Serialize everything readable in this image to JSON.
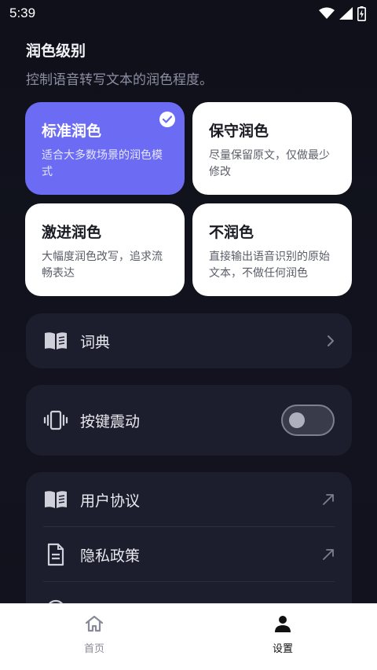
{
  "status_bar": {
    "time": "5:39",
    "icons": [
      "wifi-icon",
      "signal-icon",
      "battery-charging-icon"
    ]
  },
  "polish_level": {
    "title": "润色级别",
    "subtitle": "控制语音转写文本的润色程度。",
    "options": [
      {
        "name": "标准润色",
        "desc": "适合大多数场景的润色模式",
        "selected": true
      },
      {
        "name": "保守润色",
        "desc": "尽量保留原文，仅做最少修改",
        "selected": false
      },
      {
        "name": "激进润色",
        "desc": "大幅度润色改写，追求流畅表达",
        "selected": false
      },
      {
        "name": "不润色",
        "desc": "直接输出语音识别的原始文本，不做任何润色",
        "selected": false
      }
    ]
  },
  "dictionary": {
    "label": "词典",
    "icon": "book-icon",
    "trail_icon": "chevron-right-icon"
  },
  "vibration": {
    "label": "按键震动",
    "icon": "vibration-icon",
    "enabled": false
  },
  "links": [
    {
      "label": "用户协议",
      "icon": "book-icon",
      "trail_icon": "external-arrow-icon"
    },
    {
      "label": "隐私政策",
      "icon": "document-icon",
      "trail_icon": "external-arrow-icon"
    }
  ],
  "bottom_nav": [
    {
      "label": "首页",
      "icon": "home-icon",
      "active": false
    },
    {
      "label": "设置",
      "icon": "person-icon",
      "active": true
    }
  ],
  "colors": {
    "background": "#0f1019",
    "panel": "#1d1e2d",
    "accent": "#6b6bf4",
    "card": "#ffffff"
  }
}
